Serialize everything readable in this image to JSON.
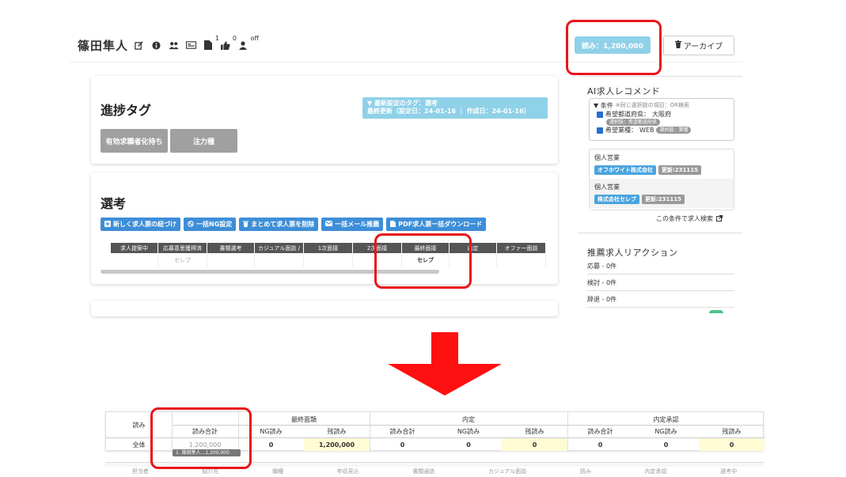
{
  "header": {
    "candidate_name": "篠田隼人",
    "icons": [
      "edit-icon",
      "info-icon",
      "users-icon",
      "card-icon",
      "doc-icon",
      "thumbs-up-icon",
      "user-off-icon"
    ],
    "badge_doc": "1",
    "badge_like": "0",
    "badge_off": "off",
    "yomi_button": "読み：1,200,000",
    "archive_button": "アーカイブ"
  },
  "progress_tag": {
    "title": "進捗タグ",
    "tags": [
      "有効求職者化待ち",
      "注力種"
    ],
    "latest_line1": "▼ 最新設定のタグ：選考",
    "latest_line2": "最終更新（設定日：24-01-16 ｜ 作成日：24-01-16）"
  },
  "selection": {
    "title": "選考",
    "actions": [
      {
        "icon": "plus-square-icon",
        "label": "新しく求人票の紐づけ"
      },
      {
        "icon": "ban-icon",
        "label": "一括NG設定"
      },
      {
        "icon": "trash-icon",
        "label": "まとめて求人票を削除"
      },
      {
        "icon": "mail-icon",
        "label": "一括メール推薦"
      },
      {
        "icon": "file-icon",
        "label": "PDF求人票一括ダウンロード"
      }
    ],
    "columns": [
      "求人提案中",
      "応募意思獲得済",
      "書類選考",
      "カジュアル面談 /",
      "1次面接",
      "2次面接",
      "最終面接",
      "内定",
      "オファー面談"
    ],
    "row": [
      "",
      "セレブ",
      "",
      "",
      "",
      "",
      "セレブ",
      "",
      ""
    ]
  },
  "ai_recommend": {
    "title": "AI求人レコメンド",
    "condition_header": "▼ 条件",
    "condition_note": "※同じ選択肢の項目：OR検索",
    "conditions": [
      {
        "label": "希望都道府県：",
        "value": "大阪府",
        "pill": "選択肢：希望都道府県"
      },
      {
        "label": "希望業種：",
        "value": "WEB",
        "pill": "選択肢：業種"
      }
    ],
    "items": [
      {
        "type": "個人営業",
        "company": "オフホワイト株式会社",
        "update": "更新:231115"
      },
      {
        "type": "個人営業",
        "company": "株式会社セレブ",
        "update": "更新:231115"
      }
    ],
    "search_link": "この条件で求人検索"
  },
  "reactions": {
    "title": "推薦求人リアクション",
    "items": [
      "応募 - 0件",
      "検討 - 0件",
      "辞退 - 0件"
    ]
  },
  "summary_table": {
    "row_header": "読み",
    "groups": [
      "最終面類",
      "内定",
      "内定承認"
    ],
    "subheaders": [
      "読み合計",
      "NG読み",
      "残読み",
      "読み合計",
      "NG読み",
      "残読み",
      "読み合計",
      "NG読み",
      "残読み"
    ],
    "row_label": "全体",
    "values": [
      "1,200,000",
      "0",
      "1,200,000",
      "0",
      "0",
      "0",
      "0",
      "0",
      "0"
    ],
    "tooltip": "1. 篠田隼人...1,200,000",
    "bottom_row": [
      "担当者",
      "紹介先",
      "職種",
      "年収見込",
      "書類通過",
      "カジュアル面談",
      "読み",
      "内定承認",
      "選考中"
    ]
  }
}
